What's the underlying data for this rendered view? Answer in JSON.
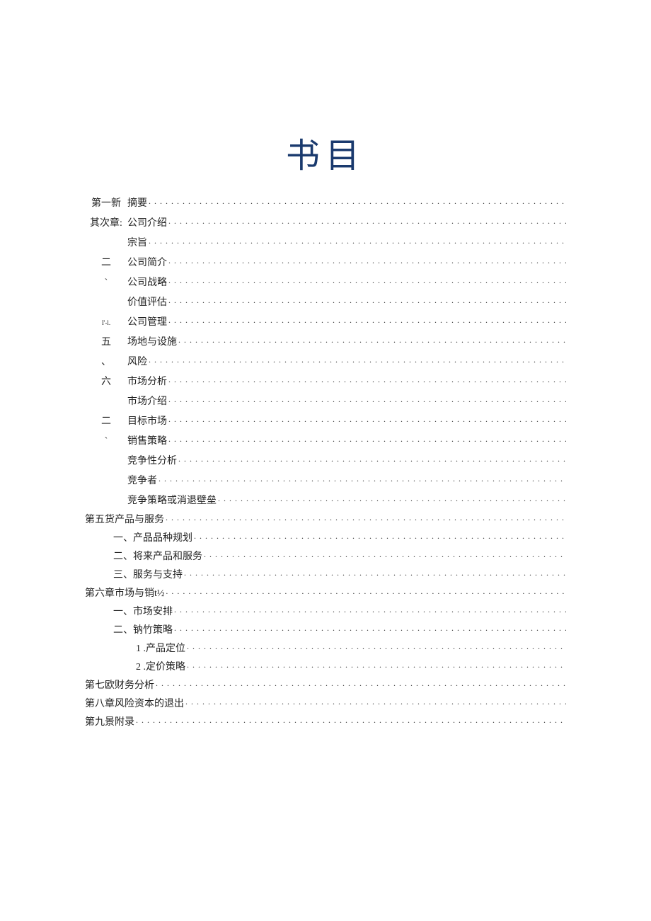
{
  "title": "书目",
  "leftMarkers": [
    "第一新",
    "其次章:",
    "",
    "二",
    "`",
    "",
    "I'-l.",
    "五",
    "、",
    "六",
    "",
    "二",
    "`",
    "",
    "",
    ""
  ],
  "topEntries": [
    "摘要",
    "公司介绍",
    "宗旨",
    "公司简介",
    "公司战略",
    "价值评估",
    "公司管理",
    "场地与设施",
    "风险",
    "市场分析",
    "市场介绍",
    "目标市场",
    "销售策略",
    "竞争性分析",
    "竞争者",
    "竞争策略或消退壁垒"
  ],
  "bottomEntries": [
    {
      "text": "第五货产品与服务",
      "indent": 0
    },
    {
      "text": "一、产品品种规划",
      "indent": 1
    },
    {
      "text": "二、将来产品和服务",
      "indent": 1
    },
    {
      "text": "三、服务与支持",
      "indent": 1
    },
    {
      "text": "第六章市场与销t½",
      "indent": 0
    },
    {
      "text": "一、市场安排",
      "indent": 1
    },
    {
      "text": "二、钠竹策略",
      "indent": 1
    },
    {
      "text": "1 .产品定位",
      "indent": 2
    },
    {
      "text": "2 .定价策略",
      "indent": 2
    },
    {
      "text": "第七欧财务分析",
      "indent": 0
    },
    {
      "text": "第八章风险资本的退出",
      "indent": 0
    },
    {
      "text": "第九景附录",
      "indent": 0
    }
  ]
}
